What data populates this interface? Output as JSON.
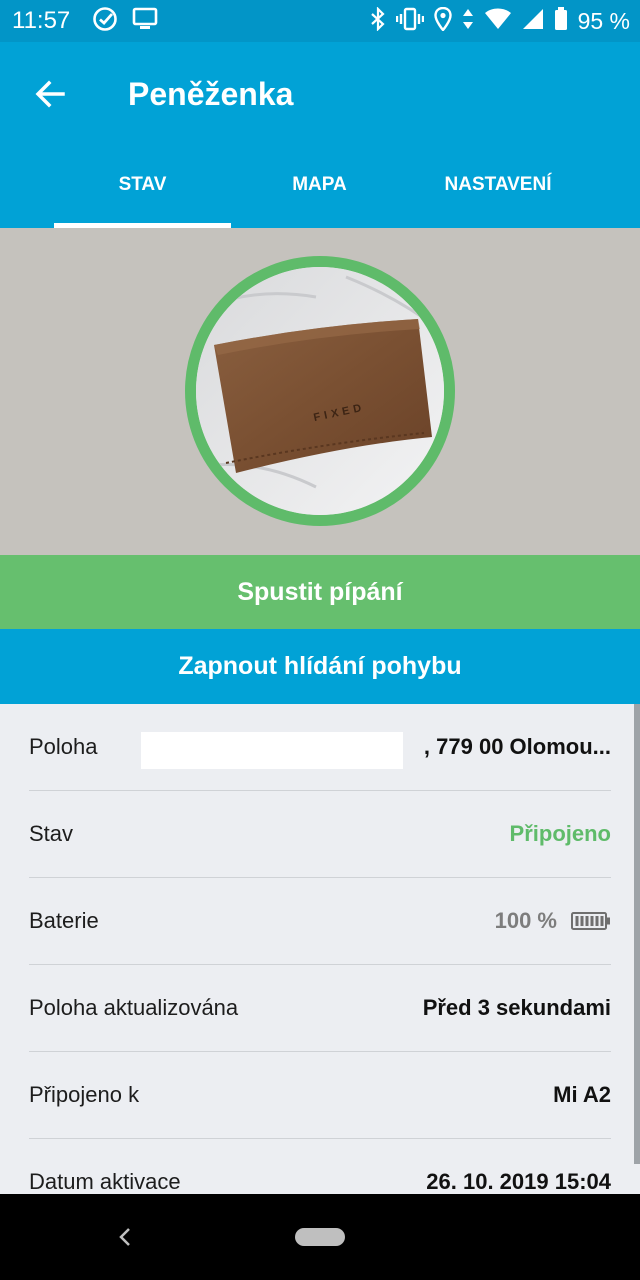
{
  "status_bar": {
    "time": "11:57",
    "battery_text": "95 %",
    "icons": [
      "check-circle-icon",
      "screen-icon",
      "bluetooth-icon",
      "vibrate-icon",
      "location-icon",
      "data-arrows-icon",
      "wifi-icon",
      "signal-icon",
      "battery-icon"
    ]
  },
  "app_bar": {
    "title": "Peněženka",
    "tabs": [
      {
        "label": "STAV",
        "active": true
      },
      {
        "label": "MAPA",
        "active": false
      },
      {
        "label": "NASTAVENÍ",
        "active": false
      }
    ]
  },
  "device": {
    "ring_color": "#5fbb6a",
    "brand_mark": "FIXED"
  },
  "actions": {
    "beep_label": "Spustit pípání",
    "motion_label": "Zapnout hlídání pohybu"
  },
  "info": {
    "rows": [
      {
        "label": "Poloha",
        "value": ", 779 00 Olomou..."
      },
      {
        "label": "Stav",
        "value": "Připojeno"
      },
      {
        "label": "Baterie",
        "value": "100 %",
        "battery_level": 1.0
      },
      {
        "label": "Poloha aktualizována",
        "value": "Před 3 sekundami"
      },
      {
        "label": "Připojeno k",
        "value": "Mi A2"
      },
      {
        "label": "Datum aktivace",
        "value": "26. 10. 2019 15:04"
      }
    ]
  },
  "colors": {
    "primary": "#01a2d6",
    "status_bar": "#0295c7",
    "green": "#66bf6e",
    "connected_text": "#5fbb6a"
  }
}
